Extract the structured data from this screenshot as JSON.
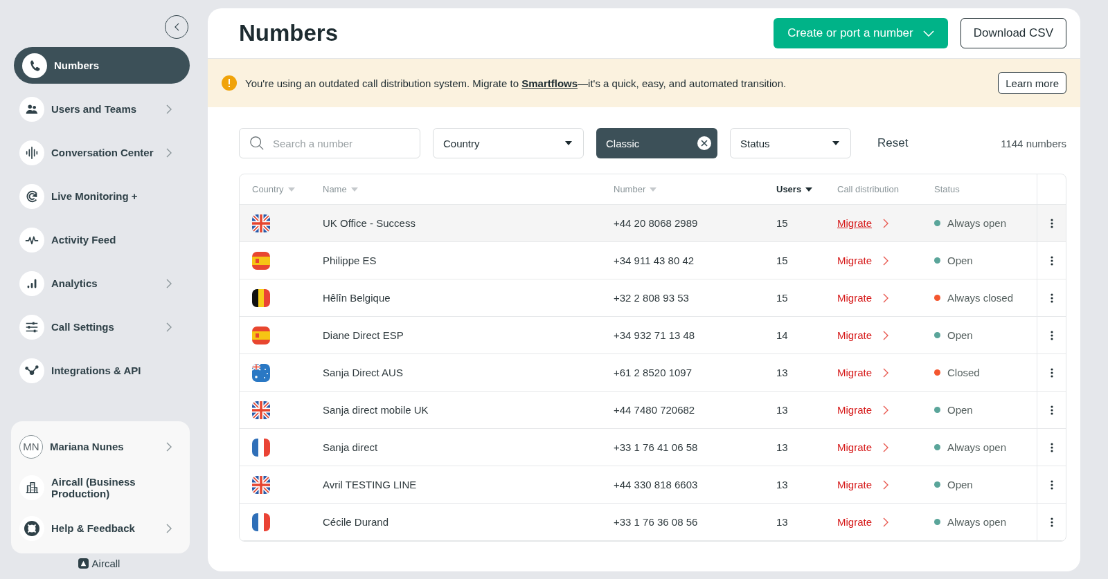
{
  "sidebar": {
    "items": [
      {
        "label": "Numbers",
        "selected": true,
        "expandable": false
      },
      {
        "label": "Users and Teams",
        "selected": false,
        "expandable": true
      },
      {
        "label": "Conversation Center",
        "selected": false,
        "expandable": true
      },
      {
        "label": "Live Monitoring +",
        "selected": false,
        "expandable": false
      },
      {
        "label": "Activity Feed",
        "selected": false,
        "expandable": false
      },
      {
        "label": "Analytics",
        "selected": false,
        "expandable": true
      },
      {
        "label": "Call Settings",
        "selected": false,
        "expandable": true
      },
      {
        "label": "Integrations & API",
        "selected": false,
        "expandable": false
      }
    ],
    "account": [
      {
        "initials": "MN",
        "label": "Mariana Nunes",
        "expandable": true
      },
      {
        "label": "Aircall (Business Production)",
        "expandable": false
      },
      {
        "label": "Help & Feedback",
        "expandable": true
      }
    ],
    "brand": "Aircall"
  },
  "page": {
    "title": "Numbers",
    "primary_button": "Create or port a number",
    "secondary_button": "Download CSV"
  },
  "banner": {
    "text_before": "You're using an outdated call distribution system. Migrate to ",
    "link": "Smartflows",
    "text_after": "—it's a quick, easy, and automated transition.",
    "button": "Learn more"
  },
  "filters": {
    "search_placeholder": "Search a number",
    "country": "Country",
    "chip": "Classic",
    "status": "Status",
    "reset": "Reset",
    "count": "1144 numbers"
  },
  "table": {
    "columns": [
      {
        "label": "Country",
        "sortable": true,
        "sorted": false
      },
      {
        "label": "Name",
        "sortable": true,
        "sorted": false
      },
      {
        "label": "Number",
        "sortable": true,
        "sorted": false
      },
      {
        "label": "Users",
        "sortable": true,
        "sorted": true
      },
      {
        "label": "Call distribution",
        "sortable": false,
        "sorted": false
      },
      {
        "label": "Status",
        "sortable": false,
        "sorted": false
      }
    ],
    "rows": [
      {
        "kind": "uk",
        "name": "UK Office - Success",
        "number": "+44 20 8068 2989",
        "users": "15",
        "action": "Migrate",
        "status": "Always open",
        "color": "#5aa59a",
        "hovered": true
      },
      {
        "kind": "es",
        "name": "Philippe ES",
        "number": "+34 911 43 80 42",
        "users": "15",
        "action": "Migrate",
        "status": "Open",
        "color": "#5aa59a",
        "hovered": false
      },
      {
        "kind": "be",
        "name": "Hêlîn Belgique",
        "number": "+32 2 808 93 53",
        "users": "15",
        "action": "Migrate",
        "status": "Always closed",
        "color": "#f4562f",
        "hovered": false
      },
      {
        "kind": "es",
        "name": "Diane Direct ESP",
        "number": "+34 932 71 13 48",
        "users": "14",
        "action": "Migrate",
        "status": "Open",
        "color": "#5aa59a",
        "hovered": false
      },
      {
        "kind": "au",
        "name": "Sanja Direct AUS",
        "number": "+61 2 8520 1097",
        "users": "13",
        "action": "Migrate",
        "status": "Closed",
        "color": "#f4562f",
        "hovered": false
      },
      {
        "kind": "uk",
        "name": "Sanja direct mobile UK",
        "number": "+44 7480 720682",
        "users": "13",
        "action": "Migrate",
        "status": "Open",
        "color": "#5aa59a",
        "hovered": false
      },
      {
        "kind": "fr",
        "name": "Sanja direct",
        "number": "+33 1 76 41 06 58",
        "users": "13",
        "action": "Migrate",
        "status": "Always open",
        "color": "#5aa59a",
        "hovered": false
      },
      {
        "kind": "uk",
        "name": "Avril TESTING LINE",
        "number": "+44 330 818 6603",
        "users": "13",
        "action": "Migrate",
        "status": "Open",
        "color": "#5aa59a",
        "hovered": false
      },
      {
        "kind": "fr",
        "name": "Cécile Durand",
        "number": "+33 1 76 36 08 56",
        "users": "13",
        "action": "Migrate",
        "status": "Always open",
        "color": "#5aa59a",
        "hovered": false
      }
    ]
  }
}
